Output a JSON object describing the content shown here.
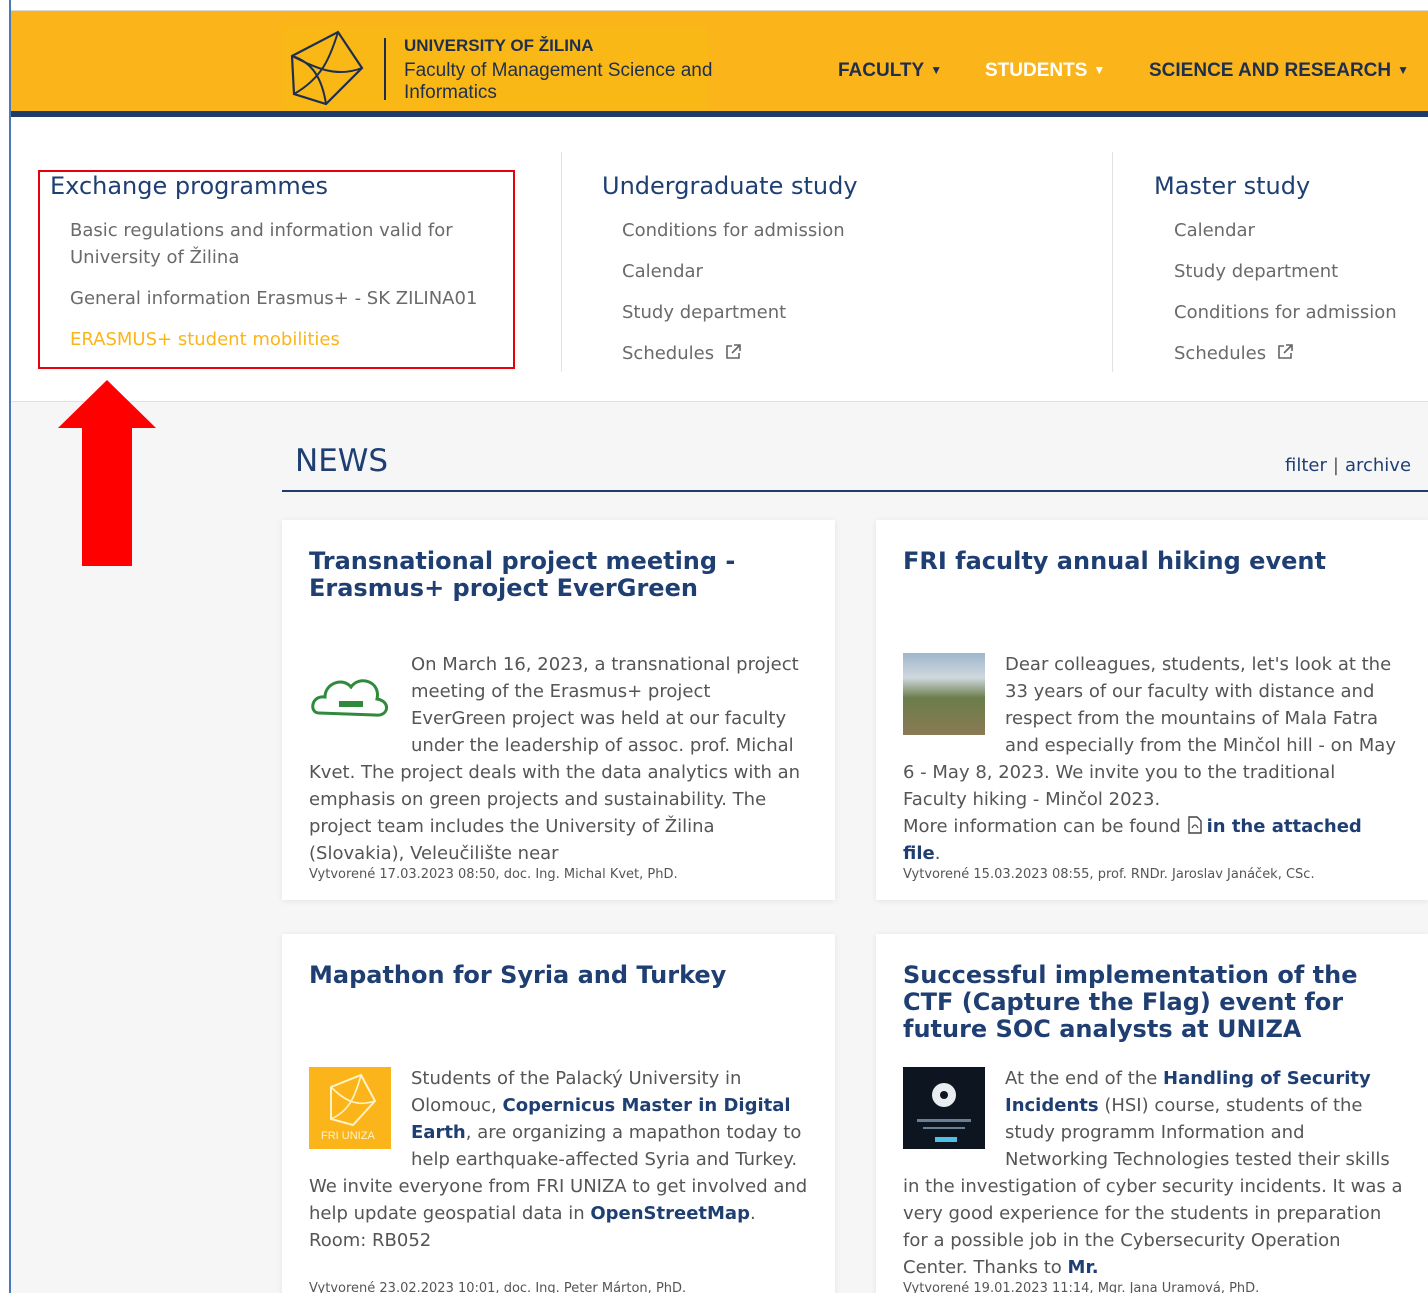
{
  "header": {
    "logo_title": "UNIVERSITY OF ŽILINA",
    "logo_subtitle": "Faculty of Management Science and Informatics",
    "nav": {
      "faculty": "FACULTY",
      "students": "STUDENTS",
      "science": "SCIENCE AND RESEARCH"
    }
  },
  "menu": {
    "exchange": {
      "heading": "Exchange programmes",
      "items": [
        "Basic regulations and information valid for",
        "University of Žilina",
        "General information Erasmus+ - SK ZILINA01",
        "ERASMUS+ student mobilities"
      ]
    },
    "undergrad": {
      "heading": "Undergraduate study",
      "items": [
        "Conditions for admission",
        "Calendar",
        "Study department",
        "Schedules"
      ]
    },
    "master": {
      "heading": "Master study",
      "items": [
        "Calendar",
        "Study department",
        "Conditions for admission",
        "Schedules"
      ]
    }
  },
  "news": {
    "title": "NEWS",
    "filter": "filter",
    "separator": "|",
    "archive": "archive",
    "cards": [
      {
        "title": "Transnational project meeting - Erasmus+ project EverGreen",
        "body": "On March 16, 2023, a transnational project meeting of the Erasmus+ project EverGreen project was held at our faculty under the leadership of assoc. prof. Michal Kvet. The project deals with the data analytics with an emphasis on green projects and sustainability. The project team includes the University of Žilina (Slovakia), Veleučilište near",
        "meta": "Vytvorené 17.03.2023 08:50, doc. Ing. Michal Kvet, PhD."
      },
      {
        "title": "FRI faculty annual hiking event",
        "body": "Dear colleagues, students, let's look at the 33 years of our faculty with distance and respect from the mountains of Mala Fatra and especially from the Minčol hill - on May 6 - May 8, 2023. We invite you to the traditional Faculty hiking - Minčol 2023.",
        "more_prefix": "More information can be found",
        "more_link": "in the attached file",
        "more_suffix": ".",
        "meta": "Vytvorené 15.03.2023 08:55, prof. RNDr. Jaroslav Janáček, CSc."
      },
      {
        "title": "Mapathon for Syria and Turkey",
        "body_1": "Students of the Palacký University in Olomouc,",
        "link_1": "Copernicus Master in Digital Earth",
        "body_2": ", are organizing a mapathon today to help earthquake-affected Syria and Turkey.",
        "body_3": "We invite everyone from FRI UNIZA to get involved and help update geospatial data in",
        "link_2": "OpenStreetMap",
        "body_4": ".",
        "room": "Room: RB052",
        "thumb_label": "FRI UNIZA",
        "meta": "Vytvorené 23.02.2023 10:01, doc. Ing. Peter Márton, PhD."
      },
      {
        "title": "Successful implementation of the CTF (Capture the Flag) event for future SOC analysts at UNIZA",
        "body_1": "At the end of the",
        "link_1": "Handling of Security Incidents",
        "body_2": "(HSI) course, students of the study programm Information and Networking Technologies tested their skills in the investigation of cyber security incidents. It was a very good experience for the students in preparation for a possible job in the Cybersecurity Operation Center. Thanks to",
        "link_2": "Mr.",
        "meta": "Vytvorené 19.01.2023 11:14, Mgr. Jana Uramová, PhD."
      }
    ]
  },
  "colors": {
    "brand_yellow": "#fbb51a",
    "navy": "#1f3f73",
    "highlight_red": "#e8000b"
  }
}
